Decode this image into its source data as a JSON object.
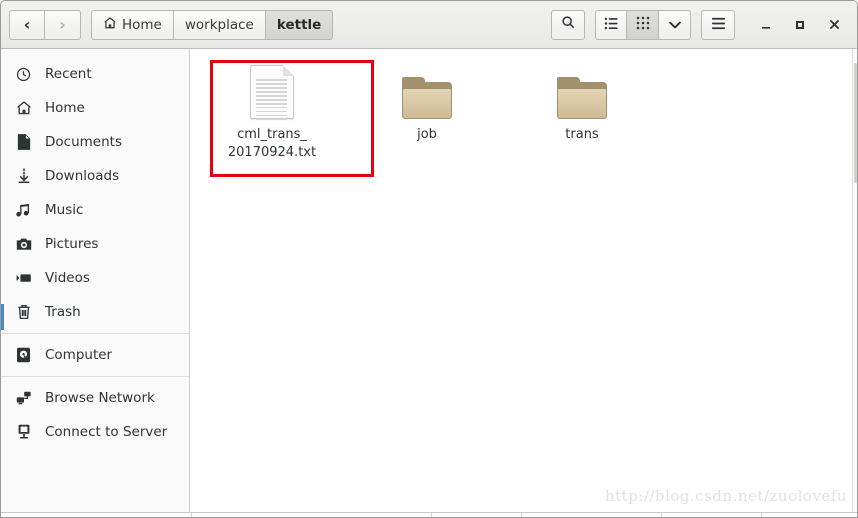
{
  "window": {
    "nav": {
      "back_label": "‹",
      "forward_label": "›"
    },
    "breadcrumb": [
      {
        "label": "Home",
        "icon": "home-icon",
        "active": false
      },
      {
        "label": "workplace",
        "icon": "",
        "active": false
      },
      {
        "label": "kettle",
        "icon": "",
        "active": true
      }
    ],
    "toolbar": {
      "search_label": "Search",
      "view_list_label": "List View",
      "view_grid_label": "Icon View",
      "view_options_label": "View Options",
      "menu_label": "Main Menu"
    },
    "controls": {
      "minimize_label": "_",
      "maximize_label": "□",
      "close_label": "✕"
    }
  },
  "sidebar": {
    "items": [
      {
        "label": "Recent",
        "icon": "clock-icon"
      },
      {
        "label": "Home",
        "icon": "home-icon"
      },
      {
        "label": "Documents",
        "icon": "document-icon"
      },
      {
        "label": "Downloads",
        "icon": "download-icon"
      },
      {
        "label": "Music",
        "icon": "music-note-icon"
      },
      {
        "label": "Pictures",
        "icon": "camera-icon"
      },
      {
        "label": "Videos",
        "icon": "video-icon"
      },
      {
        "label": "Trash",
        "icon": "trash-icon"
      },
      {
        "label": "Computer",
        "icon": "computer-disk-icon"
      },
      {
        "label": "Browse Network",
        "icon": "network-icon"
      },
      {
        "label": "Connect to Server",
        "icon": "server-icon"
      }
    ]
  },
  "main": {
    "files": [
      {
        "name": "cml_trans_\n20170924.txt",
        "type": "text-file",
        "selected": false,
        "annotated": true
      },
      {
        "name": "job",
        "type": "folder",
        "selected": false,
        "annotated": false
      },
      {
        "name": "trans",
        "type": "folder",
        "selected": false,
        "annotated": false
      }
    ],
    "file_names": {
      "f0_line1": "cml_trans_",
      "f0_line2": "20170924.txt",
      "f1": "job",
      "f2": "trans"
    },
    "annotation_color": "#e60012",
    "watermark": "http://blog.csdn.net/zuolovefu"
  }
}
